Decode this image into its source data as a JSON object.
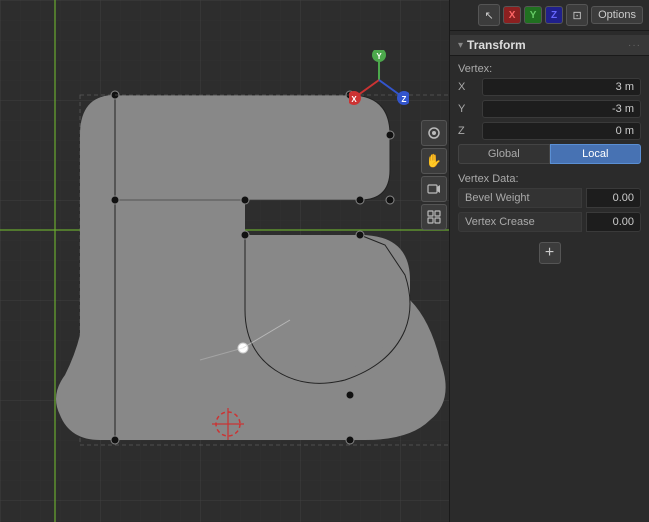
{
  "panel": {
    "topbar": {
      "cursor_icon": "↖",
      "axis_x": "X",
      "axis_y": "Y",
      "axis_z": "Z",
      "lock_icon": "⊡",
      "options_label": "Options"
    },
    "transform": {
      "section_title": "Transform",
      "collapse_icon": "▾",
      "dots": "···",
      "vertex_label": "Vertex:",
      "x_label": "X",
      "x_value": "3 m",
      "y_label": "Y",
      "y_value": "-3 m",
      "z_label": "Z",
      "z_value": "0 m",
      "global_label": "Global",
      "local_label": "Local",
      "vertex_data_label": "Vertex Data:",
      "bevel_weight_label": "Bevel Weight",
      "bevel_weight_value": "0.00",
      "vertex_crease_label": "Vertex Crease",
      "vertex_crease_value": "0.00",
      "add_label": "+"
    }
  },
  "viewport": {
    "sidebar_icons": [
      {
        "name": "grab-icon",
        "symbol": "✋"
      },
      {
        "name": "camera-icon",
        "symbol": "🎥"
      },
      {
        "name": "grid-icon",
        "symbol": "⊞"
      }
    ]
  }
}
